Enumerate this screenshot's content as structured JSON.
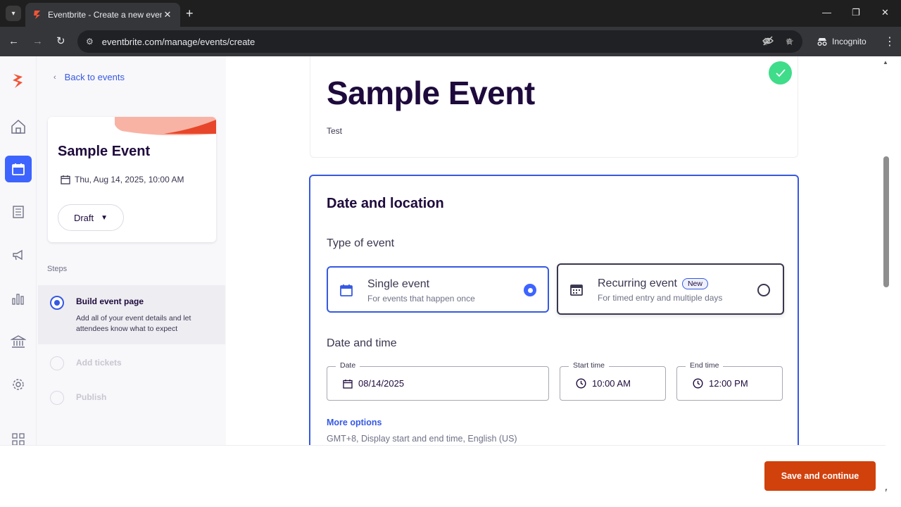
{
  "browser": {
    "tab_title": "Eventbrite - Create a new event",
    "url": "eventbrite.com/manage/events/create",
    "profile": "Incognito"
  },
  "sidebar": {
    "back_label": "Back to events",
    "event_name": "Sample Event",
    "event_date": "Thu, Aug 14, 2025, 10:00 AM",
    "status": "Draft",
    "steps_label": "Steps",
    "steps": [
      {
        "title": "Build event page",
        "description": "Add all of your event details and let attendees know what to expect",
        "state": "active"
      },
      {
        "title": "Add tickets",
        "state": "disabled"
      },
      {
        "title": "Publish",
        "state": "disabled"
      }
    ],
    "rail_icons": [
      "eventbrite-logo",
      "home-icon",
      "calendar-icon",
      "orders-icon",
      "megaphone-icon",
      "reports-icon",
      "finance-icon",
      "settings-icon",
      "apps-icon"
    ]
  },
  "overview": {
    "title": "Sample Event",
    "summary": "Test"
  },
  "date_location": {
    "title": "Date and location",
    "type_heading": "Type of event",
    "single": {
      "title": "Single event",
      "description": "For events that happen once",
      "selected": true
    },
    "recurring": {
      "title": "Recurring event",
      "badge": "New",
      "description": "For timed entry and multiple days",
      "selected": false
    },
    "datetime_heading": "Date and time",
    "date": {
      "label": "Date",
      "value": "08/14/2025"
    },
    "start": {
      "label": "Start time",
      "value": "10:00 AM"
    },
    "end": {
      "label": "End time",
      "value": "12:00 PM"
    },
    "more_options": "More options",
    "tz_info": "GMT+8, Display start and end time, English (US)"
  },
  "footer": {
    "save_label": "Save and continue"
  },
  "colors": {
    "brand": "#d1410c",
    "accent": "#3d64ff",
    "success": "#3fdc8a"
  }
}
